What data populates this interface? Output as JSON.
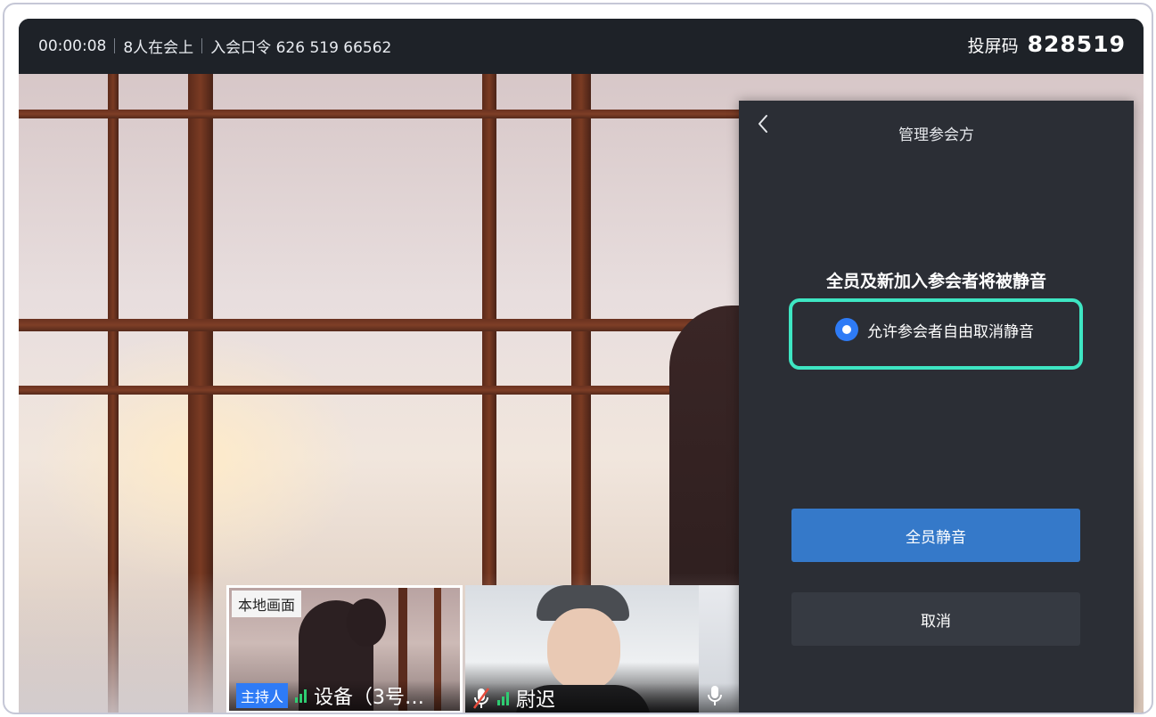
{
  "topbar": {
    "duration": "00:00:08",
    "participants": "8人在会上",
    "meeting_code": "入会口令 626 519 66562",
    "cast_label": "投屏码",
    "cast_code": "828519"
  },
  "tiles": [
    {
      "tag": "本地画面",
      "role": "主持人",
      "name": "设备（3号…"
    },
    {
      "name": "尉迟"
    }
  ],
  "panel": {
    "title": "管理参会方",
    "notice": "全员及新加入参会者将被静音",
    "option_label": "允许参会者自由取消静音",
    "option_checked": true,
    "mute_all_label": "全员静音",
    "cancel_label": "取消"
  },
  "colors": {
    "accent": "#2e7bf6",
    "highlight": "#3ee6c3",
    "primary_button": "#3579c9",
    "panel_bg": "#2b2e35"
  }
}
